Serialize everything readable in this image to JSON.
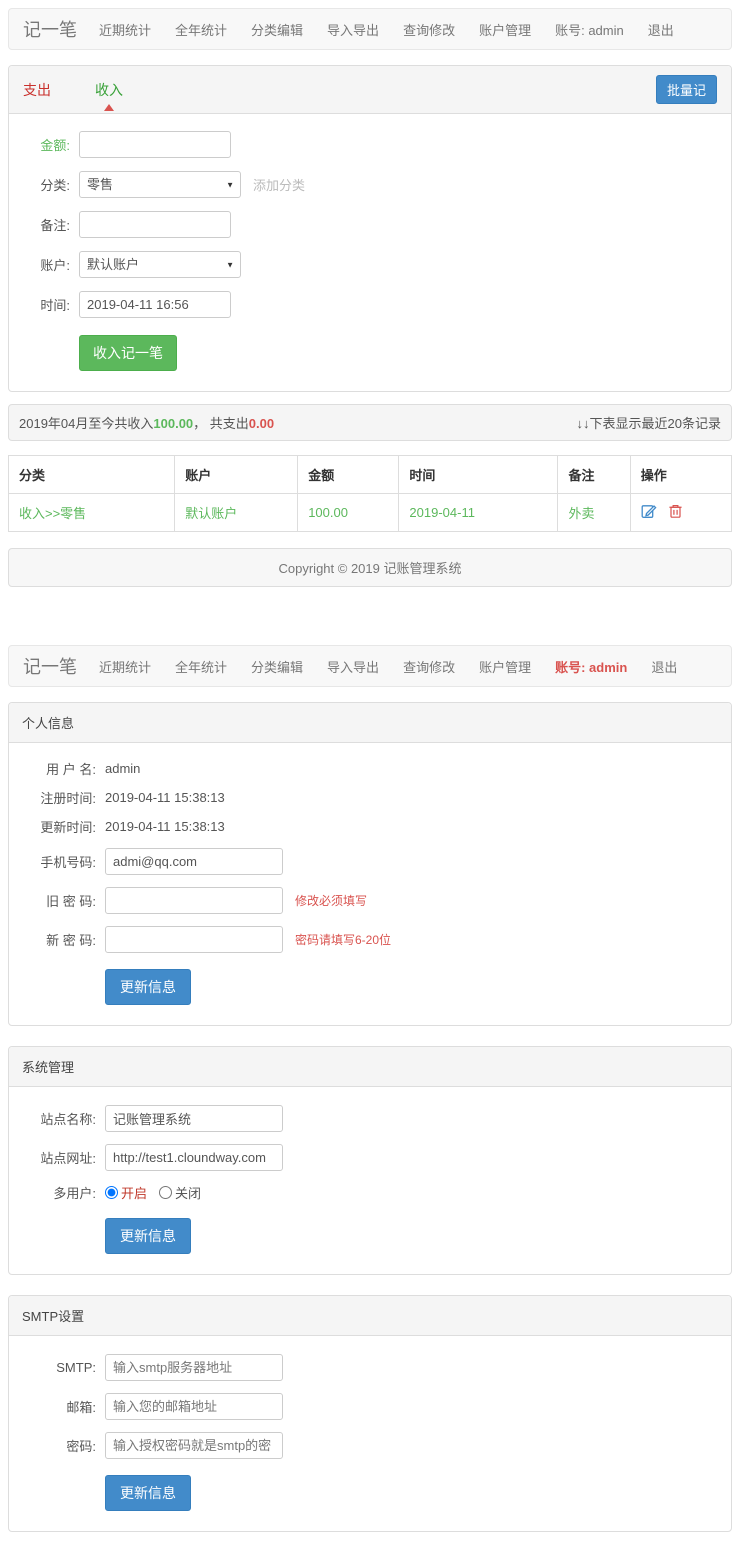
{
  "colors": {
    "green": "#5cb85c",
    "red": "#d9534f",
    "blue": "#428bca"
  },
  "icons": {
    "caret": "▼"
  },
  "navbar": {
    "brand": "记一笔",
    "links": [
      "近期统计",
      "全年统计",
      "分类编辑",
      "导入导出",
      "查询修改",
      "账户管理"
    ],
    "account": "账号: admin",
    "logout": "退出"
  },
  "entry": {
    "tab_expense": "支出",
    "tab_income": "收入",
    "batch_button": "批量记",
    "amount_label": "金额:",
    "amount_value": "",
    "category_label": "分类:",
    "category_value": "零售",
    "add_category": "添加分类",
    "note_label": "备注:",
    "note_value": "",
    "account_label": "账户:",
    "account_value": "默认账户",
    "time_label": "时间:",
    "time_value": "2019-04-11 16:56",
    "submit": "收入记一笔"
  },
  "summary": {
    "prefix": "2019年04月至今共收入",
    "income": "100.00",
    "separator": "， 共支出",
    "expense": "0.00",
    "note": "↓↓下表显示最近20条记录"
  },
  "records": {
    "headers": [
      "分类",
      "账户",
      "金额",
      "时间",
      "备注",
      "操作"
    ],
    "row": {
      "category": "收入>>零售",
      "account": "默认账户",
      "amount": "100.00",
      "time": "2019-04-11",
      "note": "外卖"
    }
  },
  "footer": {
    "copyright": "Copyright © 2019 记账管理系统"
  },
  "profile": {
    "title": "个人信息",
    "username_label": "用 户 名:",
    "username_value": "admin",
    "reg_label": "注册时间:",
    "reg_value": "2019-04-11 15:38:13",
    "upd_label": "更新时间:",
    "upd_value": "2019-04-11 15:38:13",
    "phone_label": "手机号码:",
    "phone_value": "admi@qq.com",
    "oldpwd_label": "旧 密 码:",
    "oldpwd_hint": "修改必须填写",
    "newpwd_label": "新 密 码:",
    "newpwd_hint": "密码请填写6-20位",
    "submit": "更新信息"
  },
  "system": {
    "title": "系统管理",
    "site_name_label": "站点名称:",
    "site_name_value": "记账管理系统",
    "site_url_label": "站点网址:",
    "site_url_value": "http://test1.cloundway.com",
    "multiuser_label": "多用户:",
    "multiuser_on": "开启",
    "multiuser_off": "关闭",
    "submit": "更新信息"
  },
  "smtp": {
    "title": "SMTP设置",
    "smtp_label": "SMTP:",
    "smtp_placeholder": "输入smtp服务器地址",
    "email_label": "邮箱:",
    "email_placeholder": "输入您的邮箱地址",
    "pwd_label": "密码:",
    "pwd_placeholder": "输入授权密码就是smtp的密",
    "submit": "更新信息"
  }
}
